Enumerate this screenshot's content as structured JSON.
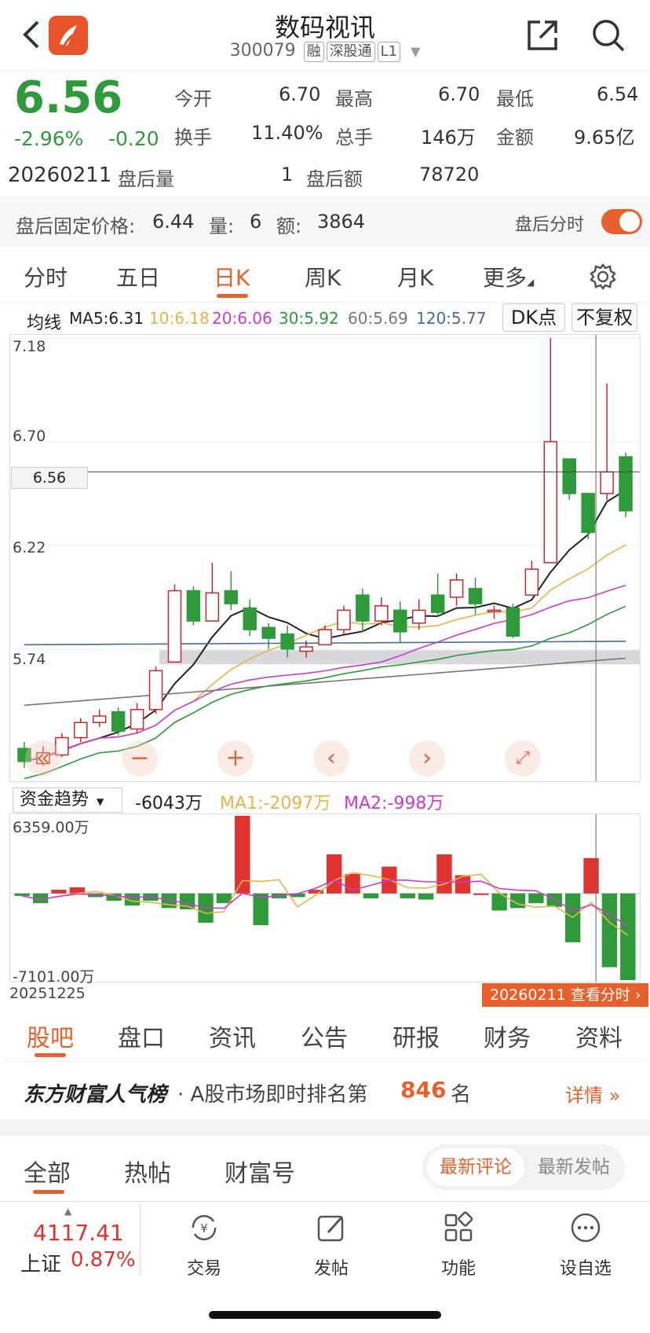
{
  "header": {
    "title": "数码视讯",
    "code": "300079",
    "tags": [
      "融",
      "深股通",
      "L1"
    ]
  },
  "quote": {
    "price": "6.56",
    "change_pct": "-2.96%",
    "change": "-0.20",
    "open_label": "今开",
    "open": "6.70",
    "high_label": "最高",
    "high": "6.70",
    "low_label": "最低",
    "low": "6.54",
    "turnover_label": "换手",
    "turnover": "11.40%",
    "volume_label": "总手",
    "volume": "146万",
    "amount_label": "金额",
    "amount": "9.65亿",
    "date": "20260211",
    "ah_vol_label": "盘后量",
    "ah_vol": "1",
    "ah_amt_label": "盘后额",
    "ah_amt": "78720",
    "fixed_label": "盘后固定价格:",
    "fixed_price": "6.44",
    "qty_label": "量:",
    "qty": "6",
    "amt_label": "额:",
    "amt": "3864",
    "ah_toggle_label": "盘后分时"
  },
  "tabs": [
    "分时",
    "五日",
    "日K",
    "周K",
    "月K",
    "更多"
  ],
  "ma": {
    "label": "均线",
    "ma5": "MA5:6.31",
    "ma10": "10:6.18",
    "ma20": "20:6.06",
    "ma30": "30:5.92",
    "ma60": "60:5.69",
    "ma120": "120:5.77"
  },
  "chart_buttons": {
    "dk": "DK点",
    "fuquan": "不复权"
  },
  "chart_data": {
    "type": "candlestick",
    "y_ticks": [
      "7.18",
      "6.70",
      "6.56",
      "6.22",
      "5.74"
    ],
    "current_price": "6.56",
    "candles": [
      [
        5.28,
        5.22,
        5.31,
        5.19
      ],
      [
        5.21,
        5.26,
        5.29,
        5.2
      ],
      [
        5.25,
        5.33,
        5.35,
        5.24
      ],
      [
        5.33,
        5.4,
        5.42,
        5.31
      ],
      [
        5.4,
        5.43,
        5.46,
        5.38
      ],
      [
        5.45,
        5.36,
        5.47,
        5.34
      ],
      [
        5.37,
        5.46,
        5.49,
        5.35
      ],
      [
        5.46,
        5.64,
        5.66,
        5.44
      ],
      [
        5.68,
        6.01,
        6.04,
        5.68
      ],
      [
        6.01,
        5.87,
        6.03,
        5.85
      ],
      [
        5.87,
        6.0,
        6.14,
        5.87
      ],
      [
        6.01,
        5.95,
        6.1,
        5.92
      ],
      [
        5.93,
        5.83,
        5.97,
        5.8
      ],
      [
        5.84,
        5.79,
        5.86,
        5.74
      ],
      [
        5.81,
        5.74,
        5.85,
        5.7
      ],
      [
        5.73,
        5.75,
        5.78,
        5.7
      ],
      [
        5.76,
        5.83,
        5.85,
        5.76
      ],
      [
        5.83,
        5.92,
        5.94,
        5.81
      ],
      [
        5.99,
        5.87,
        6.02,
        5.82
      ],
      [
        5.87,
        5.94,
        5.98,
        5.85
      ],
      [
        5.92,
        5.82,
        5.96,
        5.77
      ],
      [
        5.86,
        5.92,
        5.97,
        5.83
      ],
      [
        5.99,
        5.91,
        6.09,
        5.89
      ],
      [
        5.98,
        6.06,
        6.09,
        5.94
      ],
      [
        6.02,
        5.95,
        6.07,
        5.9
      ],
      [
        5.92,
        5.92,
        5.94,
        5.88
      ],
      [
        5.93,
        5.8,
        5.95,
        5.79
      ],
      [
        5.99,
        6.11,
        6.15,
        5.99
      ],
      [
        6.14,
        6.7,
        7.18,
        6.14
      ],
      [
        6.62,
        6.46,
        6.62,
        6.43
      ],
      [
        6.46,
        6.28,
        6.46,
        6.25
      ],
      [
        6.46,
        6.56,
        6.97,
        6.43
      ],
      [
        6.63,
        6.38,
        6.65,
        6.35
      ]
    ],
    "ma_lines": [
      "MA5",
      "MA10",
      "MA20",
      "MA30",
      "MA60",
      "MA120"
    ]
  },
  "flow": {
    "label": "资金趋势",
    "value": "-6043万",
    "ma1": "MA1:-2097万",
    "ma2": "MA2:-998万",
    "top": "6359.00万",
    "bottom": "-7101.00万",
    "start_date": "20251225",
    "end_label": "20260211 查看分时",
    "bars": [
      -200,
      -800,
      300,
      500,
      -300,
      -600,
      -1000,
      -600,
      -1200,
      -1300,
      -2400,
      -800,
      6359,
      -2600,
      -400,
      -300,
      300,
      3200,
      1600,
      -400,
      2200,
      -400,
      -500,
      3200,
      1500,
      0,
      -1400,
      -1200,
      -800,
      -1100,
      -4000,
      2900,
      -6043,
      -7101
    ]
  },
  "bottom_tabs": [
    "股吧",
    "盘口",
    "资讯",
    "公告",
    "研报",
    "财务",
    "资料"
  ],
  "rank": {
    "brand": "东方财富人气榜",
    "text": "· A股市场即时排名第",
    "num": "846",
    "unit": "名",
    "more": "详情"
  },
  "filter_tabs": [
    "全部",
    "热帖",
    "财富号"
  ],
  "sort": {
    "a": "最新评论",
    "b": "最新发帖"
  },
  "index": {
    "value": "4117.41",
    "name": "上证",
    "pct": "0.87%"
  },
  "toolbar": [
    "交易",
    "发帖",
    "功能",
    "设自选"
  ]
}
